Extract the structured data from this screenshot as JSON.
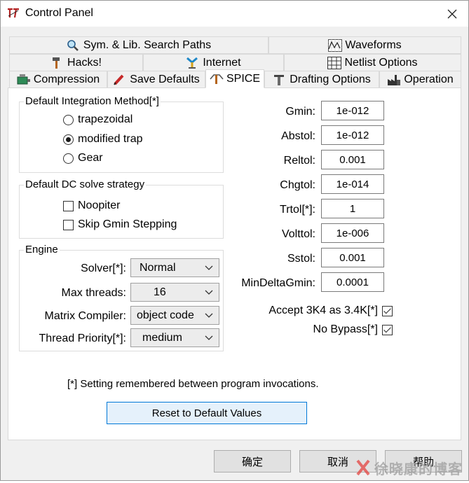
{
  "window": {
    "title": "Control Panel"
  },
  "tabs": {
    "row1": [
      {
        "label": "Sym. & Lib. Search Paths",
        "icon": "magnifier-icon"
      },
      {
        "label": "Waveforms",
        "icon": "waveform-icon"
      }
    ],
    "row2": [
      {
        "label": "Hacks!",
        "icon": "hammer-icon"
      },
      {
        "label": "Internet",
        "icon": "internet-icon"
      },
      {
        "label": "Netlist Options",
        "icon": "netlist-icon"
      }
    ],
    "row3": [
      {
        "label": "Compression",
        "icon": "compression-icon"
      },
      {
        "label": "Save Defaults",
        "icon": "pencil-icon"
      },
      {
        "label": "SPICE",
        "icon": "spice-icon",
        "active": true
      },
      {
        "label": "Drafting Options",
        "icon": "drafting-icon"
      },
      {
        "label": "Operation",
        "icon": "factory-icon"
      }
    ]
  },
  "integration": {
    "title": "Default Integration Method[*]",
    "options": [
      "trapezoidal",
      "modified trap",
      "Gear"
    ],
    "selected": "modified trap"
  },
  "dc": {
    "title": "Default DC solve strategy",
    "options": [
      {
        "label": "Noopiter",
        "checked": false
      },
      {
        "label": "Skip Gmin Stepping",
        "checked": false
      }
    ]
  },
  "engine": {
    "title": "Engine",
    "rows": [
      {
        "label": "Solver[*]:",
        "value": "Normal"
      },
      {
        "label": "Max threads:",
        "value": "16"
      },
      {
        "label": "Matrix Compiler:",
        "value": "object code"
      },
      {
        "label": "Thread Priority[*]:",
        "value": "medium"
      }
    ]
  },
  "params": [
    {
      "label": "Gmin:",
      "value": "1e-012"
    },
    {
      "label": "Abstol:",
      "value": "1e-012"
    },
    {
      "label": "Reltol:",
      "value": "0.001"
    },
    {
      "label": "Chgtol:",
      "value": "1e-014"
    },
    {
      "label": "Trtol[*]:",
      "value": "1"
    },
    {
      "label": "Volttol:",
      "value": "1e-006"
    },
    {
      "label": "Sstol:",
      "value": "0.001"
    },
    {
      "label": "MinDeltaGmin:",
      "value": "0.0001"
    }
  ],
  "flags": [
    {
      "label": "Accept 3K4 as 3.4K[*]",
      "checked": true
    },
    {
      "label": "No Bypass[*]",
      "checked": true
    }
  ],
  "note": "[*] Setting remembered between program invocations.",
  "reset_label": "Reset to Default Values",
  "buttons": {
    "ok": "确定",
    "cancel": "取消",
    "help": "帮助"
  },
  "watermark": "徐晓康的博客",
  "colors": {
    "accent": "#0078d7",
    "button_bg": "#e1e1e1",
    "panel_bg": "#ffffff",
    "window_bg": "#f0f0f0"
  }
}
